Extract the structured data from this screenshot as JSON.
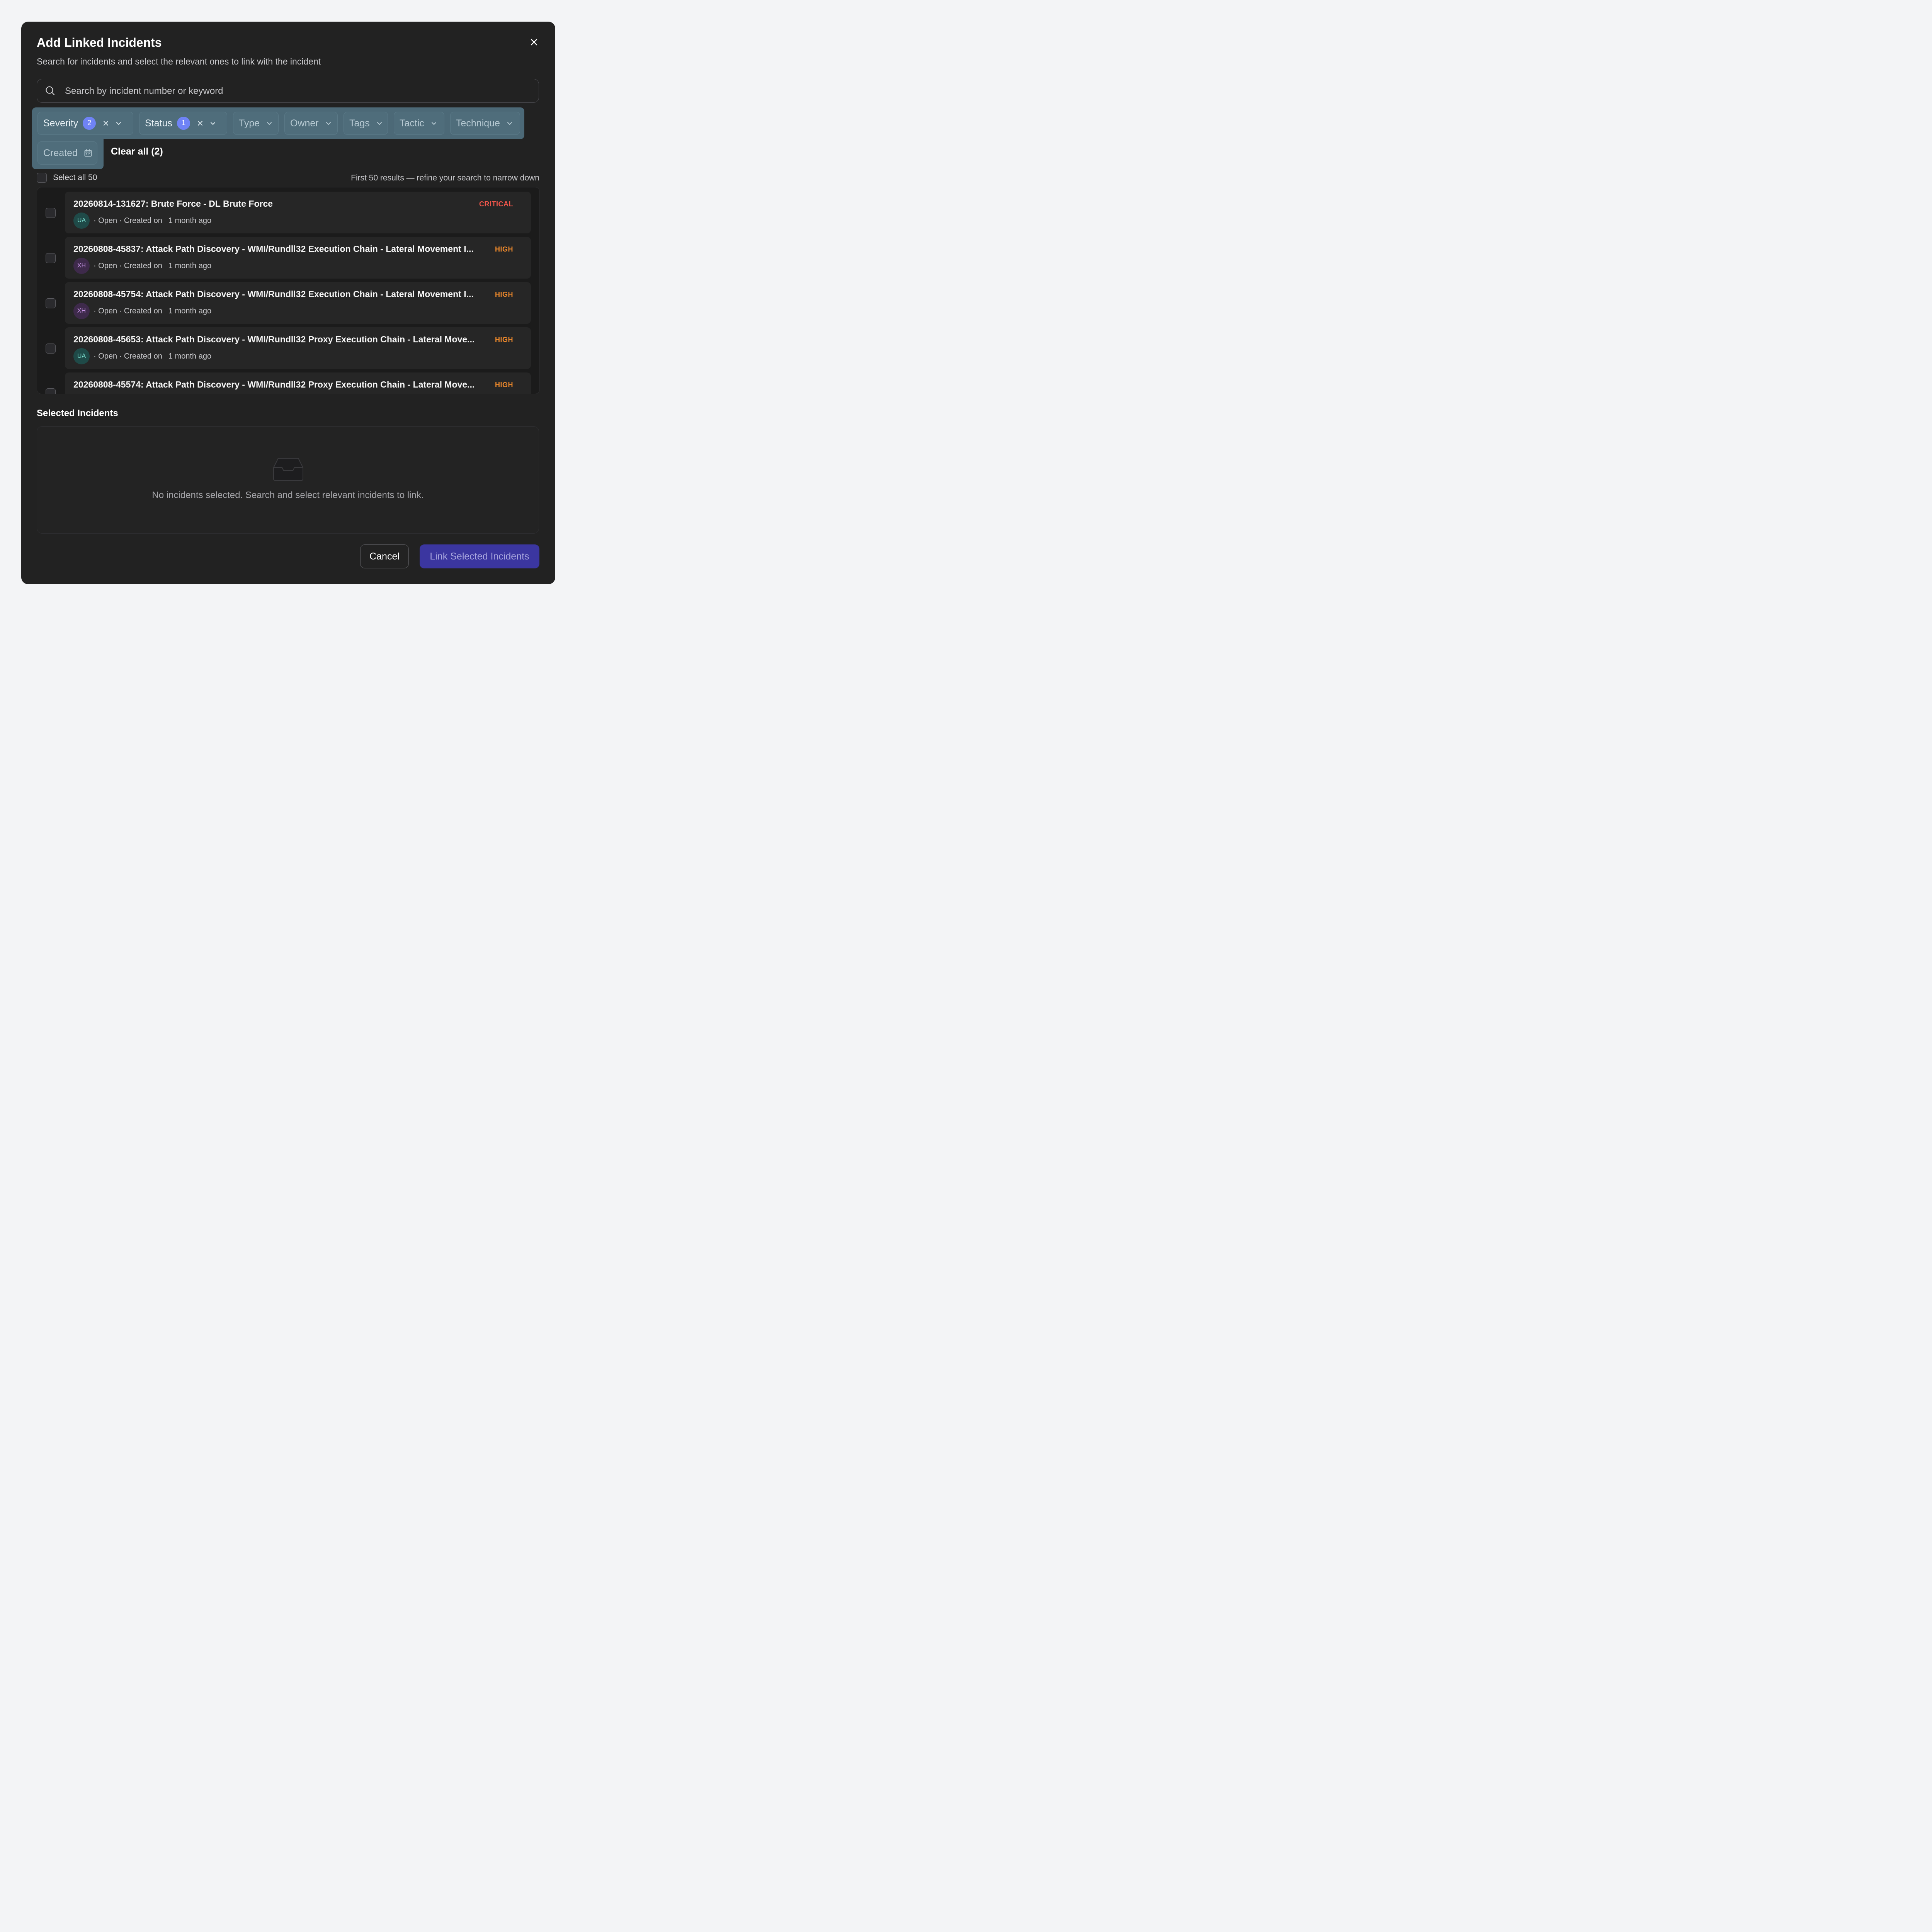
{
  "modal": {
    "title": "Add Linked Incidents",
    "subtitle": "Search for incidents and select the relevant ones to link with the incident"
  },
  "search": {
    "placeholder": "Search by incident number or keyword",
    "icon": "search-icon"
  },
  "filters": {
    "severity": {
      "label": "Severity",
      "count": "2"
    },
    "status": {
      "label": "Status",
      "count": "1"
    },
    "type": {
      "label": "Type"
    },
    "owner": {
      "label": "Owner"
    },
    "tags": {
      "label": "Tags"
    },
    "tactic": {
      "label": "Tactic"
    },
    "technique": {
      "label": "Technique"
    },
    "created": {
      "label": "Created",
      "icon": "calendar-icon"
    },
    "clear_all": "Clear all (2)",
    "highlight_color": "#4c6977"
  },
  "results": {
    "select_all": "Select all 50",
    "note": "First 50 results — refine your search to narrow down",
    "incidents": [
      {
        "title": "20260814-131627: Brute Force - DL Brute Force",
        "severity": "CRITICAL",
        "avatar": "UA",
        "status": "· Open · Created on",
        "date": "1 month ago"
      },
      {
        "title": "20260808-45837: Attack Path Discovery - WMI/Rundll32 Execution Chain - Lateral Movement I...",
        "severity": "HIGH",
        "avatar": "XH",
        "status": "· Open · Created on",
        "date": "1 month ago"
      },
      {
        "title": "20260808-45754: Attack Path Discovery - WMI/Rundll32 Execution Chain - Lateral Movement I...",
        "severity": "HIGH",
        "avatar": "XH",
        "status": "· Open · Created on",
        "date": "1 month ago"
      },
      {
        "title": "20260808-45653: Attack Path Discovery - WMI/Rundll32 Proxy Execution Chain - Lateral Move...",
        "severity": "HIGH",
        "avatar": "UA",
        "status": "· Open · Created on",
        "date": "1 month ago"
      },
      {
        "title": "20260808-45574: Attack Path Discovery - WMI/Rundll32 Proxy Execution Chain - Lateral Move...",
        "severity": "HIGH",
        "avatar": "",
        "status": "",
        "date": ""
      }
    ],
    "severity_colors": {
      "CRITICAL": "#f0564b",
      "HIGH": "#f08a2c"
    }
  },
  "selected": {
    "title": "Selected Incidents",
    "empty_icon": "inbox-icon",
    "empty_text": "No incidents selected. Search and select relevant incidents to link."
  },
  "footer": {
    "cancel": "Cancel",
    "link": "Link Selected Incidents",
    "accent": "#3b36a0"
  }
}
